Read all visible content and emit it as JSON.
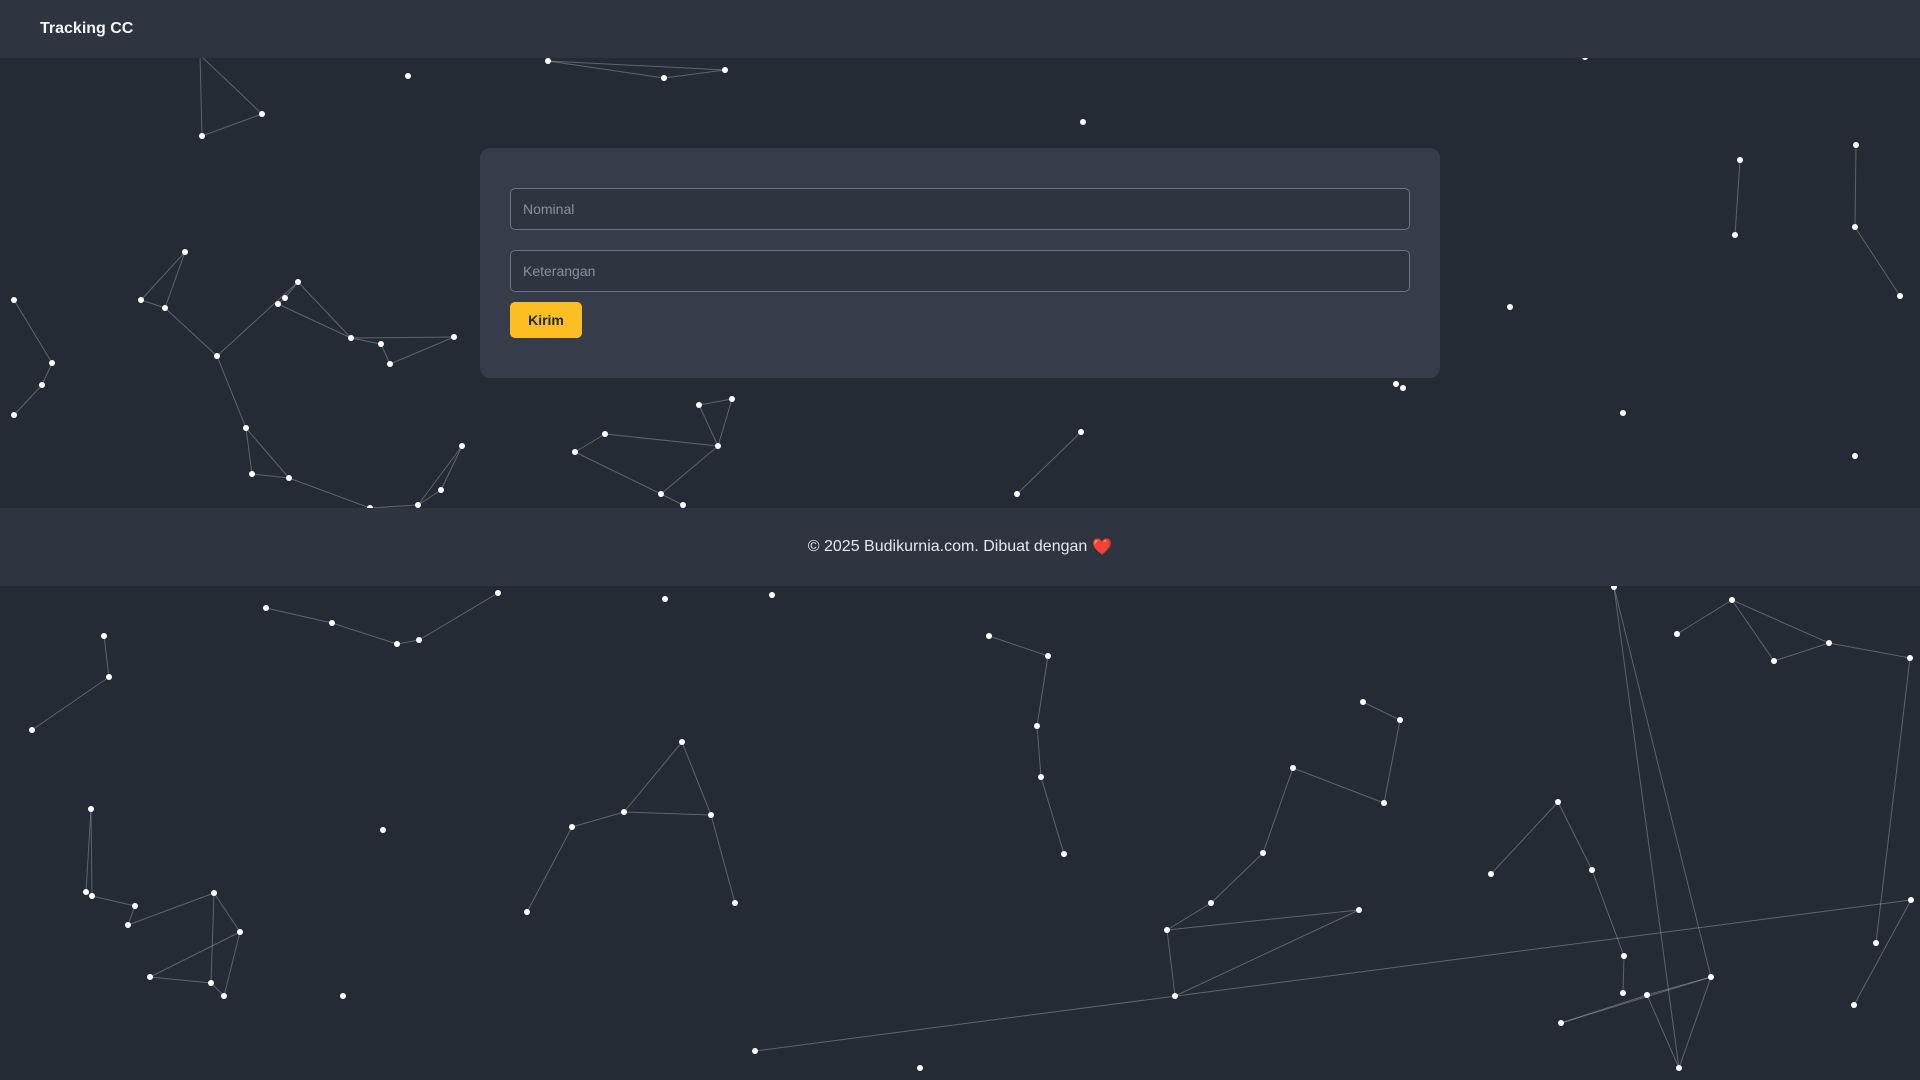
{
  "navbar": {
    "brand": "Tracking CC"
  },
  "form": {
    "nominal_placeholder": "Nominal",
    "keterangan_placeholder": "Keterangan",
    "submit_label": "Kirim"
  },
  "footer": {
    "text": "© 2025 Budikurnia.com. Dibuat dengan",
    "heart": "❤️"
  },
  "colors": {
    "background": "#252b35",
    "navbar": "#2f3540",
    "card": "#363c4a",
    "accent": "#fbbf24",
    "particle": "#ffffff"
  },
  "icons": {
    "heart": "heart-icon"
  }
}
